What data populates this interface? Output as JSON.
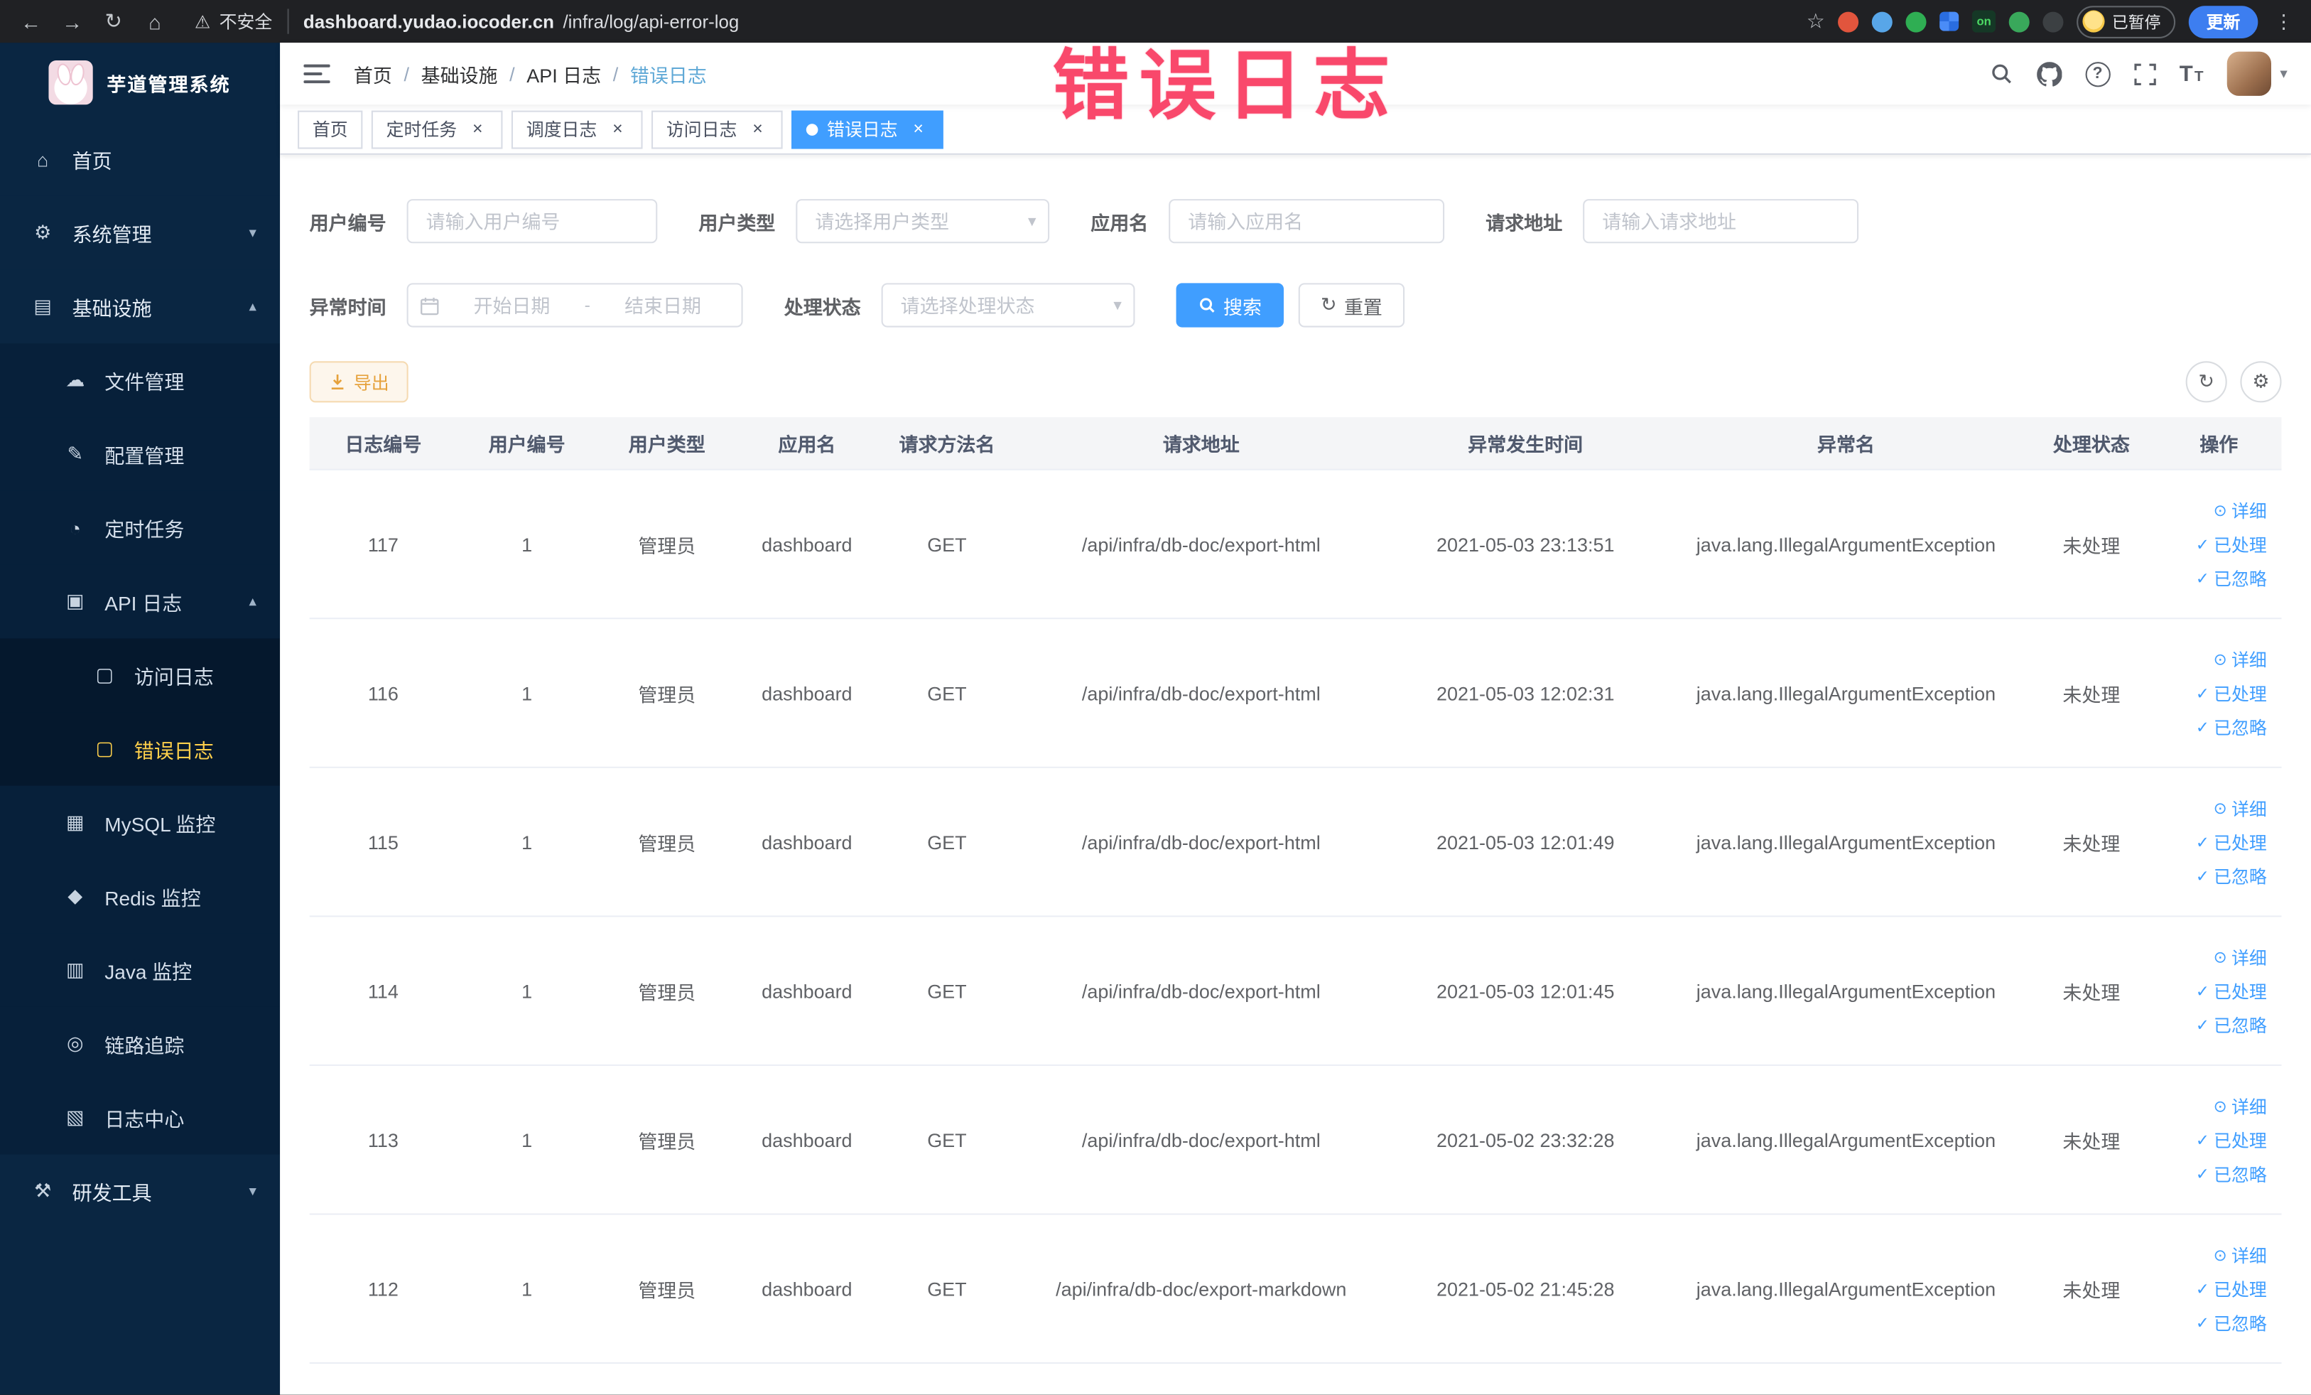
{
  "browser": {
    "security_label": "不安全",
    "url_domain": "dashboard.yudao.iocoder.cn",
    "url_path": "/infra/log/api-error-log",
    "ext_on_label": "on",
    "paused_label": "已暂停",
    "update_label": "更新"
  },
  "icons": {
    "back": "←",
    "forward": "→",
    "reload": "↻",
    "home": "⌂",
    "star": "☆",
    "kebab": "⋮",
    "warning": "⚠",
    "caret_down": "▾",
    "arrow_up": "▴",
    "arrow_down": "▾",
    "help": "?",
    "font_size": "T",
    "close": "×",
    "eye": "⊙",
    "check": "✓",
    "gear": "⚙",
    "refresh": "↻"
  },
  "annotation": "错误日志",
  "sidebar": {
    "logo_title": "芋道管理系统",
    "items": [
      {
        "label": "首页",
        "glyph": "⌂"
      },
      {
        "label": "系统管理",
        "glyph": "⚙"
      },
      {
        "label": "基础设施",
        "glyph": "▤"
      },
      {
        "label": "文件管理",
        "glyph": "☁"
      },
      {
        "label": "配置管理",
        "glyph": "✎"
      },
      {
        "label": "定时任务",
        "glyph": "◔"
      },
      {
        "label": "API 日志",
        "glyph": "▣"
      },
      {
        "label": "访问日志",
        "glyph": "▢"
      },
      {
        "label": "错误日志",
        "glyph": "▢"
      },
      {
        "label": "MySQL 监控",
        "glyph": "▦"
      },
      {
        "label": "Redis 监控",
        "glyph": "◆"
      },
      {
        "label": "Java 监控",
        "glyph": "▥"
      },
      {
        "label": "链路追踪",
        "glyph": "◎"
      },
      {
        "label": "日志中心",
        "glyph": "▧"
      },
      {
        "label": "研发工具",
        "glyph": "⚒"
      }
    ]
  },
  "header": {
    "breadcrumb": [
      "首页",
      "基础设施",
      "API 日志",
      "错误日志"
    ],
    "separator": "/"
  },
  "tabs": [
    {
      "label": "首页"
    },
    {
      "label": "定时任务"
    },
    {
      "label": "调度日志"
    },
    {
      "label": "访问日志"
    },
    {
      "label": "错误日志"
    }
  ],
  "filters": {
    "user_id_label": "用户编号",
    "user_id_placeholder": "请输入用户编号",
    "user_type_label": "用户类型",
    "user_type_placeholder": "请选择用户类型",
    "app_name_label": "应用名",
    "app_name_placeholder": "请输入应用名",
    "request_url_label": "请求地址",
    "request_url_placeholder": "请输入请求地址",
    "time_label": "异常时间",
    "time_start_placeholder": "开始日期",
    "time_separator": "-",
    "time_end_placeholder": "结束日期",
    "status_label": "处理状态",
    "status_placeholder": "请选择处理状态",
    "search_label": "搜索",
    "reset_label": "重置"
  },
  "toolbar": {
    "export_label": "导出"
  },
  "table": {
    "columns": [
      "日志编号",
      "用户编号",
      "用户类型",
      "应用名",
      "请求方法名",
      "请求地址",
      "异常发生时间",
      "异常名",
      "处理状态",
      "操作"
    ],
    "action_labels": [
      "详细",
      "已处理",
      "已忽略"
    ],
    "rows": [
      {
        "id": "117",
        "user_id": "1",
        "user_type": "管理员",
        "app_name": "dashboard",
        "method": "GET",
        "url": "/api/infra/db-doc/export-html",
        "time": "2021-05-03 23:13:51",
        "exception": "java.lang.IllegalArgumentException",
        "status": "未处理"
      },
      {
        "id": "116",
        "user_id": "1",
        "user_type": "管理员",
        "app_name": "dashboard",
        "method": "GET",
        "url": "/api/infra/db-doc/export-html",
        "time": "2021-05-03 12:02:31",
        "exception": "java.lang.IllegalArgumentException",
        "status": "未处理"
      },
      {
        "id": "115",
        "user_id": "1",
        "user_type": "管理员",
        "app_name": "dashboard",
        "method": "GET",
        "url": "/api/infra/db-doc/export-html",
        "time": "2021-05-03 12:01:49",
        "exception": "java.lang.IllegalArgumentException",
        "status": "未处理"
      },
      {
        "id": "114",
        "user_id": "1",
        "user_type": "管理员",
        "app_name": "dashboard",
        "method": "GET",
        "url": "/api/infra/db-doc/export-html",
        "time": "2021-05-03 12:01:45",
        "exception": "java.lang.IllegalArgumentException",
        "status": "未处理"
      },
      {
        "id": "113",
        "user_id": "1",
        "user_type": "管理员",
        "app_name": "dashboard",
        "method": "GET",
        "url": "/api/infra/db-doc/export-html",
        "time": "2021-05-02 23:32:28",
        "exception": "java.lang.IllegalArgumentException",
        "status": "未处理"
      },
      {
        "id": "112",
        "user_id": "1",
        "user_type": "管理员",
        "app_name": "dashboard",
        "method": "GET",
        "url": "/api/infra/db-doc/export-markdown",
        "time": "2021-05-02 21:45:28",
        "exception": "java.lang.IllegalArgumentException",
        "status": "未处理"
      }
    ]
  }
}
